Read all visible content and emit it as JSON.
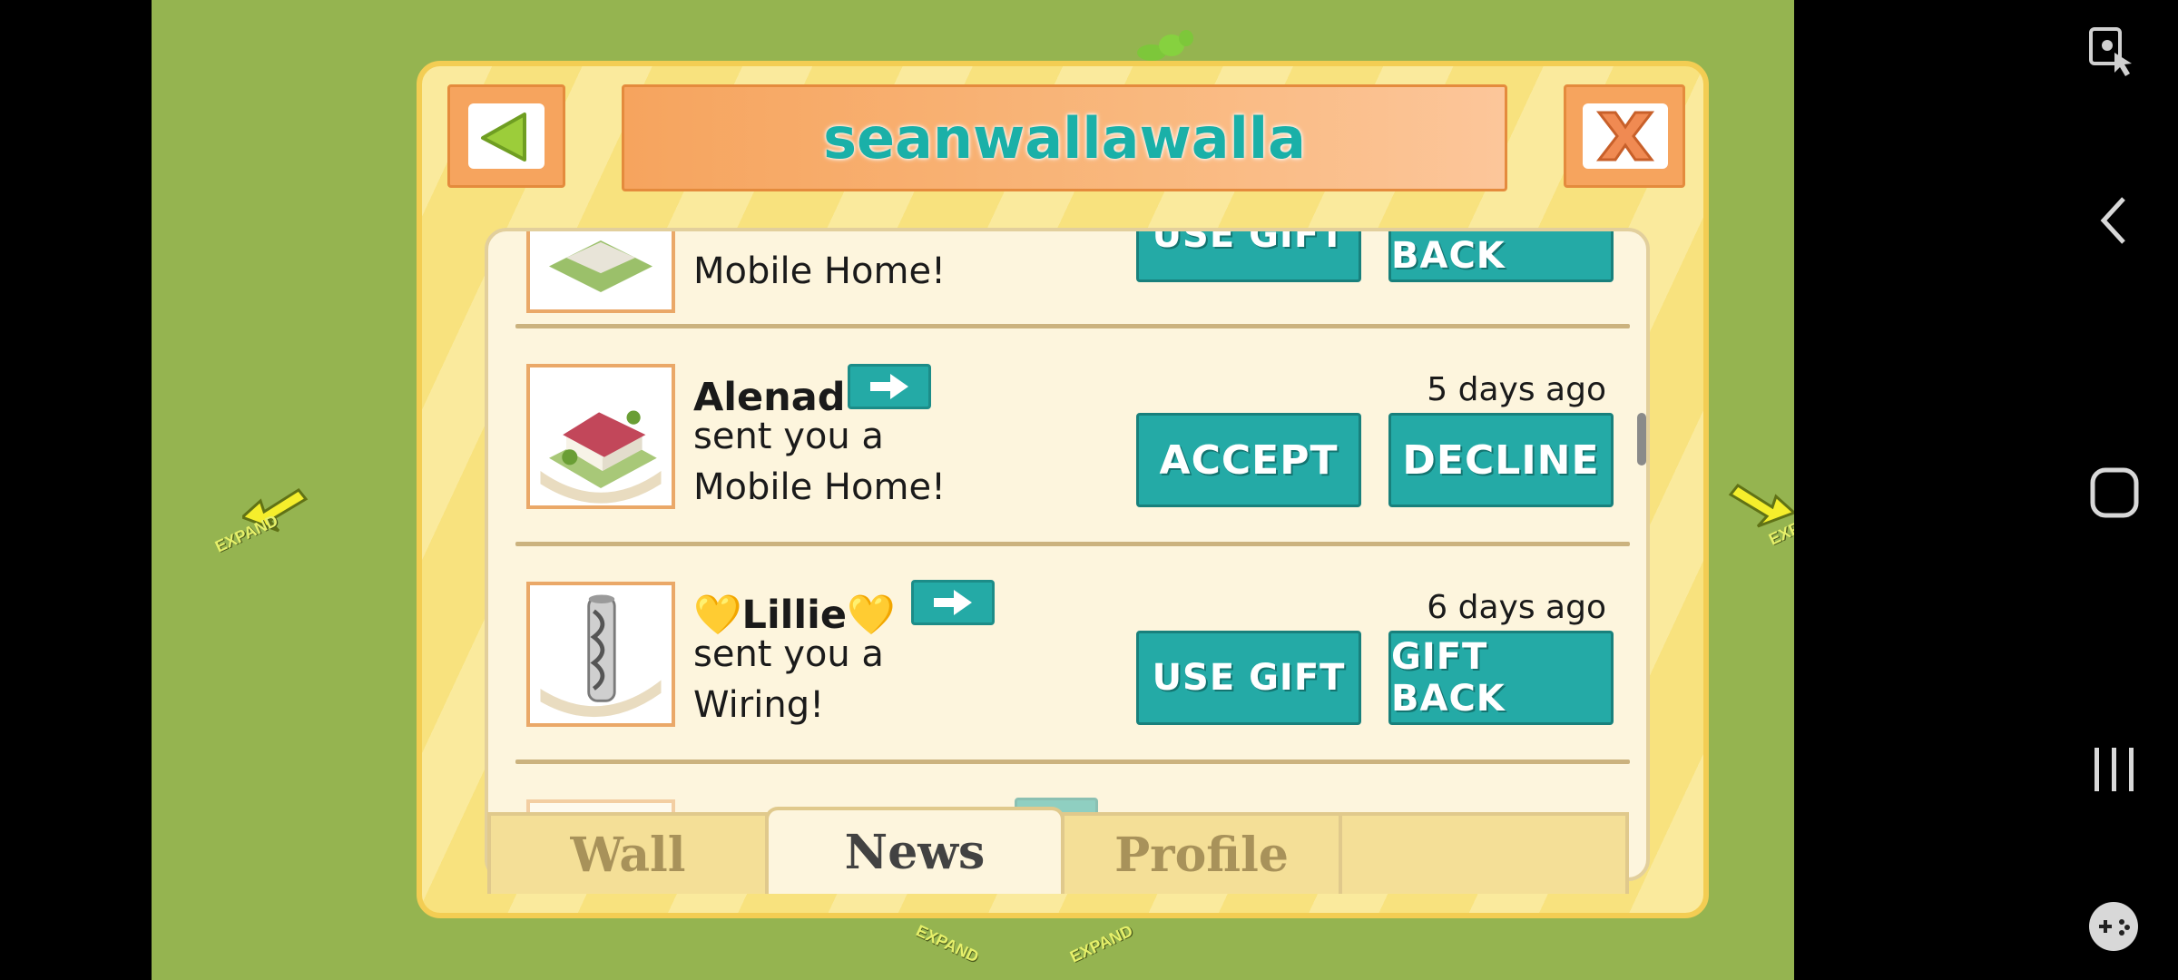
{
  "dialog": {
    "title": "seanwallawalla",
    "back_icon": "triangle-left-icon",
    "close_icon": "x-close-icon"
  },
  "feed": {
    "partial_top": {
      "message_line": "Mobile Home!",
      "buttons": [
        "USE GIFT",
        "GIFT BACK"
      ]
    },
    "items": [
      {
        "name": "Alenad",
        "line1": "sent you a",
        "line2": "Mobile Home!",
        "time": "5 days ago",
        "buttons": [
          "ACCEPT",
          "DECLINE"
        ]
      },
      {
        "name": "💛Lillie💛",
        "line1": "sent you a",
        "line2": "Wiring!",
        "time": "6 days ago",
        "buttons": [
          "USE GIFT",
          "GIFT BACK"
        ]
      }
    ]
  },
  "tabs": [
    {
      "label": "Wall",
      "active": false
    },
    {
      "label": "News",
      "active": true
    },
    {
      "label": "Profile",
      "active": false
    },
    {
      "label": "",
      "active": false
    }
  ],
  "background": {
    "expand_labels": [
      "EXPAND",
      "EXPAND",
      "EXPAND",
      "EXPAND"
    ]
  },
  "colors": {
    "accent_teal": "#24aaa6",
    "title_teal": "#1ab0a8",
    "dialog_yellow": "#f8e27e",
    "title_orange": "#f6a45e",
    "grass": "#95b450"
  }
}
